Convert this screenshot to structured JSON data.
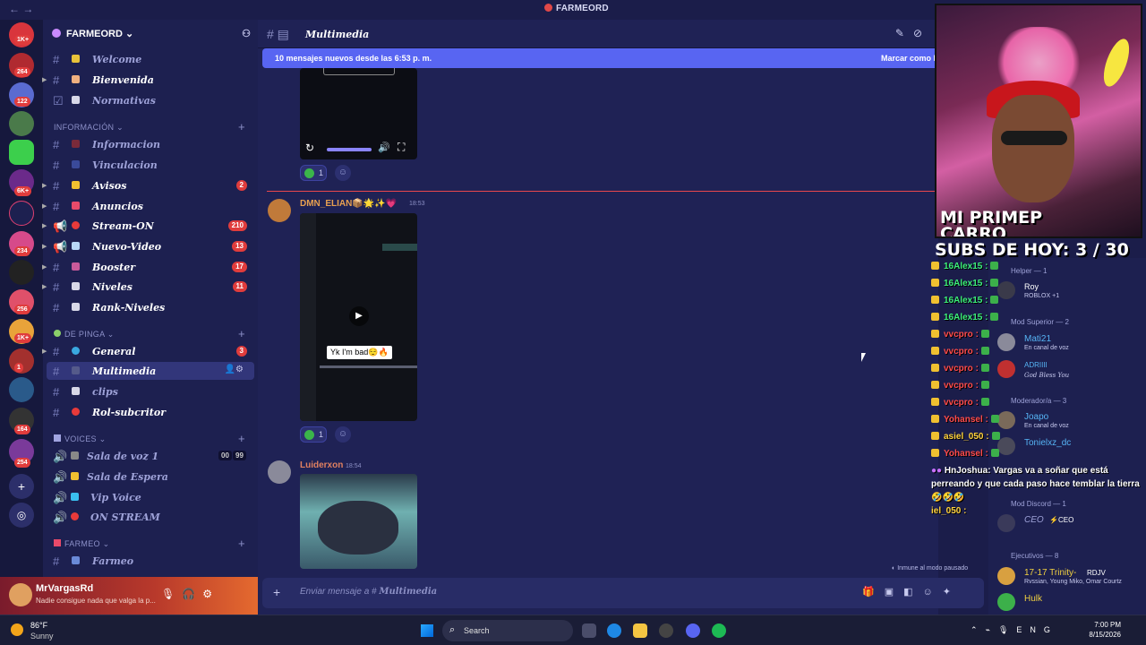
{
  "window": {
    "title": "FARMEORD",
    "nav": "←  →"
  },
  "guilds": {
    "badges": [
      "1K+",
      "264",
      "122",
      "6K+",
      "234",
      "256",
      "1K+",
      "1",
      "164",
      "254"
    ]
  },
  "server": {
    "name": "FARMEORD ⌄"
  },
  "channels": {
    "welcome": "Welcome",
    "bienvenida": "Bienvenida",
    "normativas": "Normativas",
    "cat_info": "INFORMACIÓN ⌄",
    "informacion": "Informacion",
    "vinculacion": "Vinculacion",
    "avisos": "Avisos",
    "avisos_count": "2",
    "anuncios": "Anuncios",
    "stream_on": "Stream-ON",
    "stream_on_count": "210",
    "nuevo_video": "Nuevo-Video",
    "nuevo_video_count": "13",
    "booster": "Booster",
    "booster_count": "17",
    "niveles": "Niveles",
    "niveles_count": "11",
    "rank_niveles": "Rank-Niveles",
    "cat_pinga": "DE PINGA ⌄",
    "general": "General",
    "general_count": "3",
    "multimedia": "Multimedia",
    "clips": "clips",
    "rol_subcritor": "Rol-subcritor",
    "cat_voices": "VOICES ⌄",
    "sala_voz": "Sala de voz 1",
    "sala_voz_users": "00",
    "sala_voz_limit": "99",
    "sala_espera": "Sala de Espera",
    "vip_voice": "Vip Voice",
    "on_stream": "ON STREAM",
    "cat_farmeo": "FARMEO ⌄",
    "farmeo": "Farmeo"
  },
  "user": {
    "name": "MrVargasRd",
    "status": "Nadie consigue nada que valga la p..."
  },
  "header": {
    "channel": "Multimedia"
  },
  "banner": {
    "left": "10 mensajes nuevos desde las 6:53 p. m.",
    "right": "Marcar como l"
  },
  "messages": [
    {
      "author": "DMN_ELIAN📦🌟✨💗",
      "time": "18:53",
      "overlay": "Yk I'm bad😌🔥",
      "reaction_count": "1"
    },
    {
      "author": "Luiderxon",
      "time": "18:54"
    }
  ],
  "first_reaction_count": "1",
  "input": {
    "placeholder_pre": "Enviar mensaje a # ",
    "placeholder_ch": "Multimedia"
  },
  "paused_label": "Inmune al modo pausado",
  "stream": {
    "overlay_line1": "MI PRIMEP",
    "overlay_line2": "CARRO",
    "subs": "SUBS DE HOY: 3 / 30",
    "chat": [
      {
        "name": "16Alex15 :",
        "color": "#3cf07a"
      },
      {
        "name": "16Alex15 :",
        "color": "#3cf07a"
      },
      {
        "name": "16Alex15 :",
        "color": "#3cf07a"
      },
      {
        "name": "16Alex15 :",
        "color": "#3cf07a"
      },
      {
        "name": "vvcpro :",
        "color": "#ff4b4b"
      },
      {
        "name": "vvcpro :",
        "color": "#ff4b4b"
      },
      {
        "name": "vvcpro :",
        "color": "#ff4b4b"
      },
      {
        "name": "vvcpro :",
        "color": "#ff4b4b"
      },
      {
        "name": "vvcpro :",
        "color": "#ff4b4b"
      },
      {
        "name": "Yohansel :",
        "color": "#ff4b4b"
      },
      {
        "name": "asiel_050 :",
        "color": "#ffd23c"
      },
      {
        "name": "Yohansel :",
        "color": "#ff4b4b"
      }
    ],
    "big_msg_name": "HnJoshua",
    "big_msg_text": ": Vargas va a soñar que está perreando y que cada paso hace temblar la tierra",
    "big_msg_emotes": "🤣🤣🤣",
    "last_chat": "iel_050 :"
  },
  "members": {
    "helper": "Helper — 1",
    "roy": "Roy",
    "roy_status": "ROBLOX +1",
    "mod_sup": "Mod Superior — 2",
    "mati": "Mati21",
    "mati_status": "En canal de voz",
    "adri": "ADRIIII",
    "adri_status": "God Bless You",
    "moderador": "Moderador/a — 3",
    "joapo": "Joapo",
    "joapo_status": "En canal de voz",
    "toniel": "Tonielxz_dc",
    "mod_discord": "Mod Discord — 1",
    "ceo": "CEO",
    "ceo_tag": "⚡CEO",
    "ejecutivos": "Ejecutivos — 8",
    "trinity": "17-17 Trinity-",
    "trinity_tag": "RDJV",
    "trinity_status": "Rvssian, Young Miko, Omar Courtz",
    "hulk": "Hulk"
  },
  "taskbar": {
    "temp": "86°F",
    "cond": "Sunny",
    "search": "Search",
    "lang": "ENG",
    "time": "7:00 PM",
    "date": "8/15/2026"
  }
}
